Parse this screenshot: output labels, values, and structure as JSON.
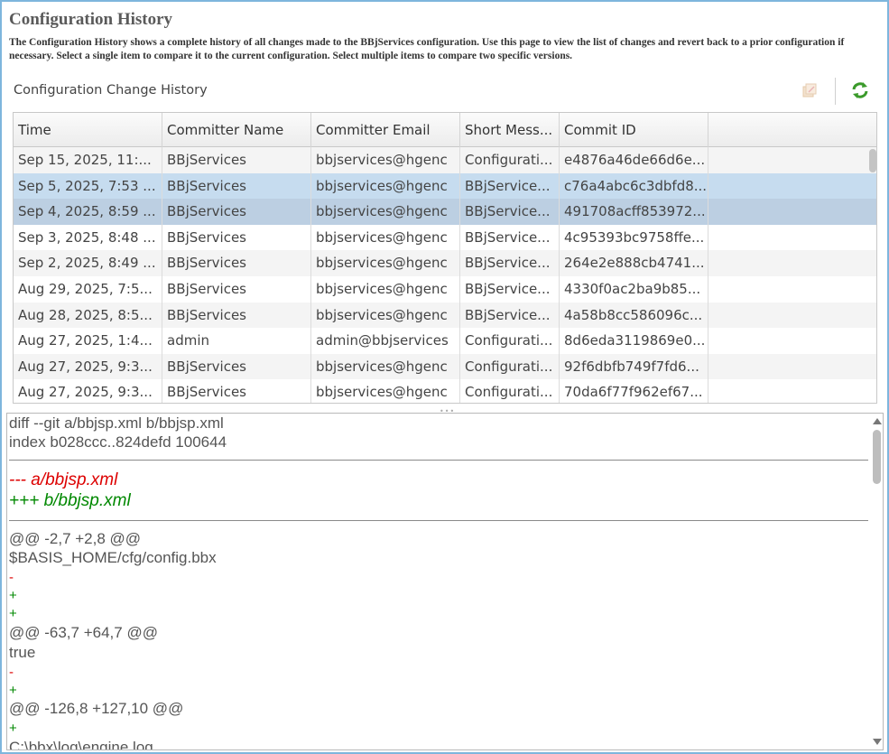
{
  "page": {
    "title": "Configuration History",
    "description": "The Configuration History shows a complete history of all changes made to the BBjServices configuration. Use this page to view the list of changes and revert back to a prior configuration if necessary. Select a single item to compare it to the current configuration. Select multiple items to compare two specific versions."
  },
  "section": {
    "label": "Configuration Change History"
  },
  "toolbar": {
    "revert_icon": "revert-icon",
    "refresh_icon": "refresh-icon",
    "refresh_color": "#3a9a2a"
  },
  "grid": {
    "columns": [
      "Time",
      "Committer Name",
      "Committer Email",
      "Short Mess...",
      "Commit ID",
      ""
    ],
    "rows": [
      [
        "Sep 15, 2025, 11:...",
        "BBjServices",
        "bbjservices@hgenc",
        "Configurati...",
        "e4876a46de66d6e..."
      ],
      [
        "Sep 5, 2025, 7:53 ...",
        "BBjServices",
        "bbjservices@hgenc",
        "BBjService...",
        "c76a4abc6c3dbfd8..."
      ],
      [
        "Sep 4, 2025, 8:59 ...",
        "BBjServices",
        "bbjservices@hgenc",
        "BBjService...",
        "491708acff853972..."
      ],
      [
        "Sep 3, 2025, 8:48 ...",
        "BBjServices",
        "bbjservices@hgenc",
        "BBjService...",
        "4c95393bc9758ffe..."
      ],
      [
        "Sep 2, 2025, 8:49 ...",
        "BBjServices",
        "bbjservices@hgenc",
        "BBjService...",
        "264e2e888cb4741..."
      ],
      [
        "Aug 29, 2025, 7:5...",
        "BBjServices",
        "bbjservices@hgenc",
        "BBjService...",
        "4330f0ac2ba9b85..."
      ],
      [
        "Aug 28, 2025, 8:5...",
        "BBjServices",
        "bbjservices@hgenc",
        "BBjService...",
        "4a58b8cc586096c..."
      ],
      [
        "Aug 27, 2025, 1:4...",
        "admin",
        "admin@bbjservices",
        "Configurati...",
        "8d6eda3119869e0..."
      ],
      [
        "Aug 27, 2025, 9:3...",
        "BBjServices",
        "bbjservices@hgenc",
        "Configurati...",
        "92f6dbfb749f7fd6..."
      ],
      [
        "Aug 27, 2025, 9:3...",
        "BBjServices",
        "bbjservices@hgenc",
        "Configurati...",
        "70da6f77f962ef67..."
      ]
    ],
    "selected_rows": [
      1,
      2
    ]
  },
  "diff": {
    "header1": "diff --git a/bbjsp.xml b/bbjsp.xml",
    "header2": "index b028ccc..824defd 100644",
    "file_a": "--- a/bbjsp.xml",
    "file_b": "+++ b/bbjsp.xml",
    "hunk1": "@@ -2,7 +2,8 @@",
    "ctx1": "$BASIS_HOME/cfg/config.bbx",
    "minus": "-",
    "plus": "+",
    "hunk2": "@@ -63,7 +64,7 @@",
    "ctx2": "true",
    "hunk3": "@@ -126,8 +127,10 @@",
    "ctx3": "C:\\bbx\\log\\engine.log",
    "del_color": "#dd0000",
    "add_color": "#008800"
  }
}
